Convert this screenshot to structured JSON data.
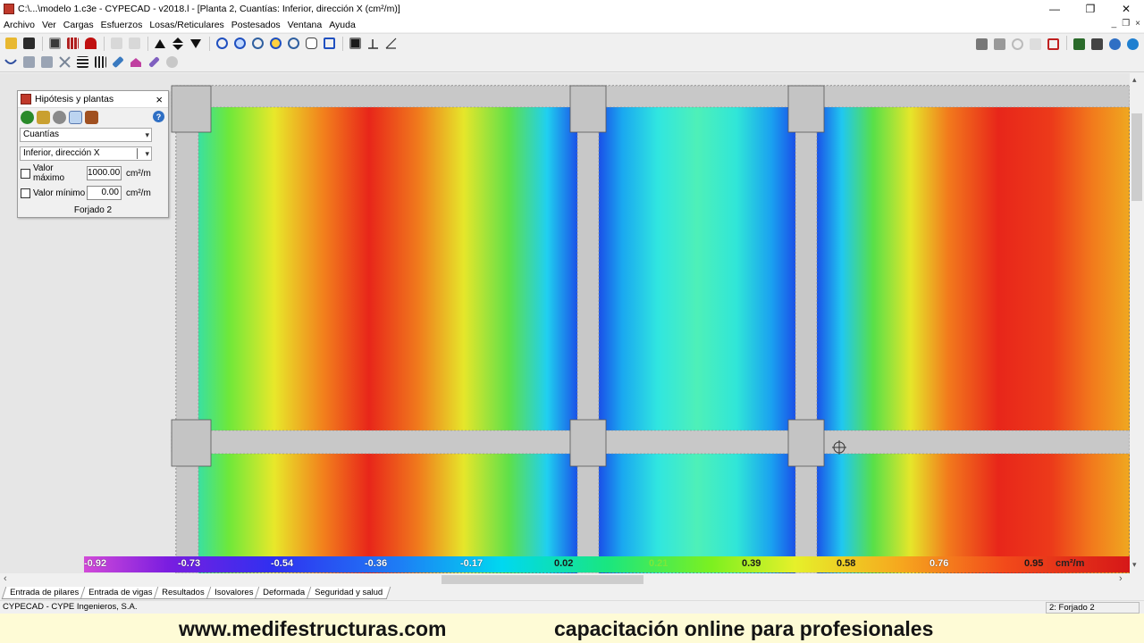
{
  "window": {
    "title": "C:\\...\\modelo 1.c3e - CYPECAD - v2018.l - [Planta 2, Cuantías: Inferior, dirección X (cm²/m)]",
    "minimize": "—",
    "maximize": "❐",
    "close": "✕"
  },
  "menu": {
    "items": [
      "Archivo",
      "Ver",
      "Cargas",
      "Esfuerzos",
      "Losas/Reticulares",
      "Postesados",
      "Ventana",
      "Ayuda"
    ],
    "mdi_min": "_",
    "mdi_restore": "❐",
    "mdi_close": "×"
  },
  "toolbar1": {
    "left_icons": [
      "open-icon",
      "save-icon",
      "report-icon",
      "grid-icon",
      "magnet-icon",
      "undo-icon",
      "redo-icon",
      "up-icon",
      "updown-icon",
      "down-icon",
      "zoom-window-icon",
      "zoom-all-icon",
      "zoom-in-icon",
      "redraw-icon",
      "zoom-out-icon",
      "pan-icon",
      "zoom-extent-icon",
      "text-icon",
      "axis-icon",
      "axes-icon"
    ],
    "right_icons": [
      "print-icon",
      "print2-icon",
      "refresh-icon",
      "options-icon",
      "export-icon",
      "config-icon",
      "layers-icon",
      "help-icon",
      "web-icon"
    ]
  },
  "toolbar2": {
    "icons": [
      "beam-icon",
      "column-icon",
      "wall-icon",
      "cross-icon",
      "table-icon",
      "table2-icon",
      "brush-icon",
      "roof-icon",
      "pencil-icon",
      "eye-icon"
    ]
  },
  "panel": {
    "title": "Hipótesis y plantas",
    "close": "×",
    "help": "?",
    "combo_type": "Cuantías",
    "combo_direction": "Inferior, dirección X",
    "max_label": "Valor máximo",
    "max_value": "1000.00",
    "min_label": "Valor mínimo",
    "min_value": "0.00",
    "unit": "cm²/m",
    "floor": "Forjado 2"
  },
  "legend": {
    "labels": [
      "-0.92",
      "-0.73",
      "-0.54",
      "-0.36",
      "-0.17",
      "0.02",
      "0.21",
      "0.39",
      "0.58",
      "0.76",
      "0.95"
    ],
    "unit": "cm²/m"
  },
  "tabs": [
    "Entrada de pilares",
    "Entrada de vigas",
    "Resultados",
    "Isovalores",
    "Deformada",
    "Seguridad y salud"
  ],
  "status": {
    "left": "CYPECAD - CYPE Ingenieros, S.A.",
    "right": "2: Forjado 2"
  },
  "banner": {
    "site": "www.medifestructuras.com",
    "slogan": "capacitación online para profesionales"
  },
  "colors": {
    "slab_red": "#e8261a",
    "slab_yellow": "#f0e22a",
    "slab_green": "#3ce060",
    "slab_cyan": "#28e0f0",
    "slab_blue": "#1f6ff0",
    "beam_gray": "#c8c8c8"
  }
}
